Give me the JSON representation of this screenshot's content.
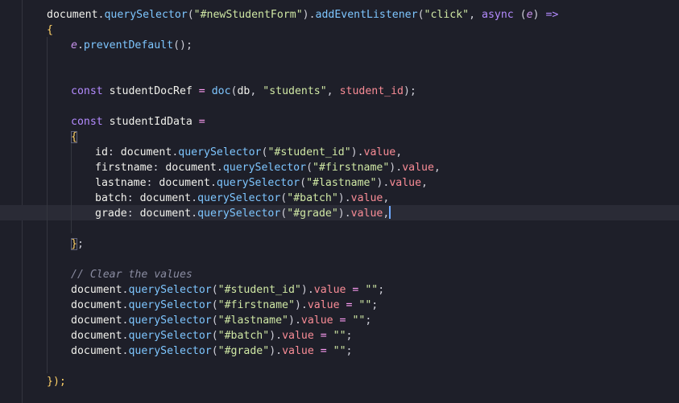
{
  "editor": {
    "colors": {
      "background": "#1e1f29",
      "current_line": "#2a2b36",
      "default": "#f1f1ec",
      "keyword": "#b48bff",
      "function": "#7ec6ff",
      "string": "#cfe7a4",
      "param": "#c792ea",
      "property": "#f98c96",
      "punctuation": "#cfcfd8",
      "operator": "#ff9df5",
      "brace": "#ffd166",
      "comment": "#8a8ca1"
    },
    "lines": [
      {
        "indent": 58,
        "tokens": [
          [
            "document",
            "default"
          ],
          [
            ".",
            "punctuation"
          ],
          [
            "querySelector",
            "function"
          ],
          [
            "(",
            "punctuation"
          ],
          [
            "\"#newStudentForm\"",
            "string"
          ],
          [
            ").",
            "punctuation"
          ],
          [
            "addEventListener",
            "function"
          ],
          [
            "(",
            "punctuation"
          ],
          [
            "\"click\"",
            "string"
          ],
          [
            ", ",
            "punctuation"
          ],
          [
            "async",
            "keyword"
          ],
          [
            " (",
            "punctuation"
          ],
          [
            "e",
            "param"
          ],
          [
            ") ",
            "punctuation"
          ],
          [
            "=>",
            "keyword"
          ]
        ]
      },
      {
        "indent": 58,
        "tokens": [
          [
            "{",
            "brace"
          ]
        ]
      },
      {
        "indent": 88,
        "tokens": [
          [
            "e",
            "param"
          ],
          [
            ".",
            "punctuation"
          ],
          [
            "preventDefault",
            "function"
          ],
          [
            "();",
            "punctuation"
          ]
        ]
      },
      {
        "indent": 58,
        "tokens": []
      },
      {
        "indent": 58,
        "tokens": []
      },
      {
        "indent": 88,
        "tokens": [
          [
            "const",
            "keyword"
          ],
          [
            " studentDocRef ",
            "default"
          ],
          [
            "=",
            "operator"
          ],
          [
            " ",
            "default"
          ],
          [
            "doc",
            "function"
          ],
          [
            "(",
            "punctuation"
          ],
          [
            "db",
            "default"
          ],
          [
            ", ",
            "punctuation"
          ],
          [
            "\"students\"",
            "string"
          ],
          [
            ", ",
            "punctuation"
          ],
          [
            "student_id",
            "property"
          ],
          [
            ");",
            "punctuation"
          ]
        ]
      },
      {
        "indent": 58,
        "tokens": []
      },
      {
        "indent": 88,
        "tokens": [
          [
            "const",
            "keyword"
          ],
          [
            " studentIdData ",
            "default"
          ],
          [
            "=",
            "operator"
          ]
        ]
      },
      {
        "indent": 88,
        "tokens": [
          [
            "{",
            "brace"
          ]
        ]
      },
      {
        "indent": 118,
        "tokens": [
          [
            "id",
            "default"
          ],
          [
            ": ",
            "punctuation"
          ],
          [
            "document",
            "default"
          ],
          [
            ".",
            "punctuation"
          ],
          [
            "querySelector",
            "function"
          ],
          [
            "(",
            "punctuation"
          ],
          [
            "\"#student_id\"",
            "string"
          ],
          [
            ").",
            "punctuation"
          ],
          [
            "value",
            "property"
          ],
          [
            ",",
            "punctuation"
          ]
        ]
      },
      {
        "indent": 118,
        "tokens": [
          [
            "firstname",
            "default"
          ],
          [
            ": ",
            "punctuation"
          ],
          [
            "document",
            "default"
          ],
          [
            ".",
            "punctuation"
          ],
          [
            "querySelector",
            "function"
          ],
          [
            "(",
            "punctuation"
          ],
          [
            "\"#firstname\"",
            "string"
          ],
          [
            ").",
            "punctuation"
          ],
          [
            "value",
            "property"
          ],
          [
            ",",
            "punctuation"
          ]
        ]
      },
      {
        "indent": 118,
        "tokens": [
          [
            "lastname",
            "default"
          ],
          [
            ": ",
            "punctuation"
          ],
          [
            "document",
            "default"
          ],
          [
            ".",
            "punctuation"
          ],
          [
            "querySelector",
            "function"
          ],
          [
            "(",
            "punctuation"
          ],
          [
            "\"#lastname\"",
            "string"
          ],
          [
            ").",
            "punctuation"
          ],
          [
            "value",
            "property"
          ],
          [
            ",",
            "punctuation"
          ]
        ]
      },
      {
        "indent": 118,
        "tokens": [
          [
            "batch",
            "default"
          ],
          [
            ": ",
            "punctuation"
          ],
          [
            "document",
            "default"
          ],
          [
            ".",
            "punctuation"
          ],
          [
            "querySelector",
            "function"
          ],
          [
            "(",
            "punctuation"
          ],
          [
            "\"#batch\"",
            "string"
          ],
          [
            ").",
            "punctuation"
          ],
          [
            "value",
            "property"
          ],
          [
            ",",
            "punctuation"
          ]
        ]
      },
      {
        "indent": 118,
        "tokens": [
          [
            "grade",
            "default"
          ],
          [
            ": ",
            "punctuation"
          ],
          [
            "document",
            "default"
          ],
          [
            ".",
            "punctuation"
          ],
          [
            "querySelector",
            "function"
          ],
          [
            "(",
            "punctuation"
          ],
          [
            "\"#grade\"",
            "string"
          ],
          [
            ").",
            "punctuation"
          ],
          [
            "value",
            "property"
          ],
          [
            ",",
            "punctuation"
          ]
        ],
        "cursor": true
      },
      {
        "indent": 58,
        "tokens": []
      },
      {
        "indent": 88,
        "tokens": [
          [
            "}",
            "brace"
          ],
          [
            ";",
            "punctuation"
          ]
        ]
      },
      {
        "indent": 58,
        "tokens": []
      },
      {
        "indent": 88,
        "tokens": [
          [
            "// Clear the values",
            "comment"
          ]
        ]
      },
      {
        "indent": 88,
        "tokens": [
          [
            "document",
            "default"
          ],
          [
            ".",
            "punctuation"
          ],
          [
            "querySelector",
            "function"
          ],
          [
            "(",
            "punctuation"
          ],
          [
            "\"#student_id\"",
            "string"
          ],
          [
            ").",
            "punctuation"
          ],
          [
            "value",
            "property"
          ],
          [
            " ",
            "default"
          ],
          [
            "=",
            "operator"
          ],
          [
            " ",
            "default"
          ],
          [
            "\"\"",
            "string"
          ],
          [
            ";",
            "punctuation"
          ]
        ]
      },
      {
        "indent": 88,
        "tokens": [
          [
            "document",
            "default"
          ],
          [
            ".",
            "punctuation"
          ],
          [
            "querySelector",
            "function"
          ],
          [
            "(",
            "punctuation"
          ],
          [
            "\"#firstname\"",
            "string"
          ],
          [
            ").",
            "punctuation"
          ],
          [
            "value",
            "property"
          ],
          [
            " ",
            "default"
          ],
          [
            "=",
            "operator"
          ],
          [
            " ",
            "default"
          ],
          [
            "\"\"",
            "string"
          ],
          [
            ";",
            "punctuation"
          ]
        ]
      },
      {
        "indent": 88,
        "tokens": [
          [
            "document",
            "default"
          ],
          [
            ".",
            "punctuation"
          ],
          [
            "querySelector",
            "function"
          ],
          [
            "(",
            "punctuation"
          ],
          [
            "\"#lastname\"",
            "string"
          ],
          [
            ").",
            "punctuation"
          ],
          [
            "value",
            "property"
          ],
          [
            " ",
            "default"
          ],
          [
            "=",
            "operator"
          ],
          [
            " ",
            "default"
          ],
          [
            "\"\"",
            "string"
          ],
          [
            ";",
            "punctuation"
          ]
        ]
      },
      {
        "indent": 88,
        "tokens": [
          [
            "document",
            "default"
          ],
          [
            ".",
            "punctuation"
          ],
          [
            "querySelector",
            "function"
          ],
          [
            "(",
            "punctuation"
          ],
          [
            "\"#batch\"",
            "string"
          ],
          [
            ").",
            "punctuation"
          ],
          [
            "value",
            "property"
          ],
          [
            " ",
            "default"
          ],
          [
            "=",
            "operator"
          ],
          [
            " ",
            "default"
          ],
          [
            "\"\"",
            "string"
          ],
          [
            ";",
            "punctuation"
          ]
        ]
      },
      {
        "indent": 88,
        "tokens": [
          [
            "document",
            "default"
          ],
          [
            ".",
            "punctuation"
          ],
          [
            "querySelector",
            "function"
          ],
          [
            "(",
            "punctuation"
          ],
          [
            "\"#grade\"",
            "string"
          ],
          [
            ").",
            "punctuation"
          ],
          [
            "value",
            "property"
          ],
          [
            " ",
            "default"
          ],
          [
            "=",
            "operator"
          ],
          [
            " ",
            "default"
          ],
          [
            "\"\"",
            "string"
          ],
          [
            ";",
            "punctuation"
          ]
        ]
      },
      {
        "indent": 58,
        "tokens": []
      },
      {
        "indent": 58,
        "tokens": [
          [
            "});",
            "brace"
          ]
        ]
      }
    ]
  }
}
